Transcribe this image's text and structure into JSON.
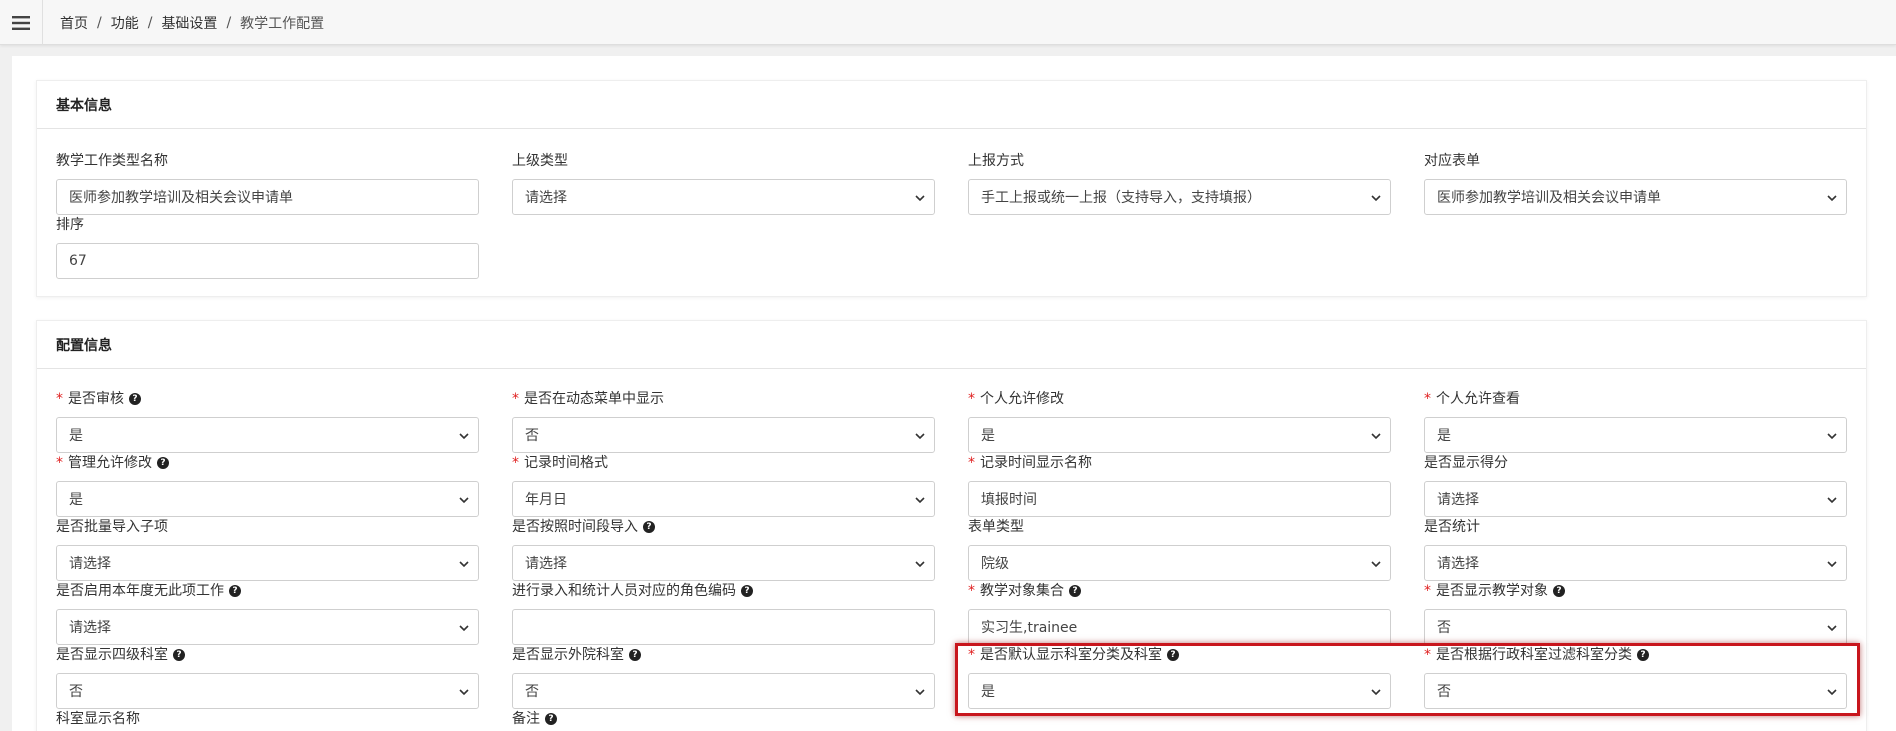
{
  "breadcrumb": {
    "items": [
      "首页",
      "功能",
      "基础设置"
    ],
    "current": "教学工作配置",
    "separator": "/"
  },
  "basic": {
    "title": "基本信息",
    "type_name": {
      "label": "教学工作类型名称",
      "value": "医师参加教学培训及相关会议申请单"
    },
    "parent_type": {
      "label": "上级类型",
      "value": "请选择"
    },
    "report_method": {
      "label": "上报方式",
      "value": "手工上报或统一上报（支持导入，支持填报）"
    },
    "form": {
      "label": "对应表单",
      "value": "医师参加教学培训及相关会议申请单"
    },
    "sort": {
      "label": "排序",
      "value": "67"
    }
  },
  "config": {
    "title": "配置信息",
    "audit": {
      "label": "是否审核",
      "value": "是"
    },
    "dynamic_menu": {
      "label": "是否在动态菜单中显示",
      "value": "否"
    },
    "personal_edit": {
      "label": "个人允许修改",
      "value": "是"
    },
    "personal_view": {
      "label": "个人允许查看",
      "value": "是"
    },
    "admin_edit": {
      "label": "管理允许修改",
      "value": "是"
    },
    "time_format": {
      "label": "记录时间格式",
      "value": "年月日"
    },
    "time_display_name": {
      "label": "记录时间显示名称",
      "value": "填报时间"
    },
    "show_score": {
      "label": "是否显示得分",
      "value": "请选择"
    },
    "batch_import": {
      "label": "是否批量导入子项",
      "value": "请选择"
    },
    "period_import": {
      "label": "是否按照时间段导入",
      "value": "请选择"
    },
    "form_type": {
      "label": "表单类型",
      "value": "院级"
    },
    "statistics": {
      "label": "是否统计",
      "value": "请选择"
    },
    "no_work_year": {
      "label": "是否启用本年度无此项工作",
      "value": "请选择"
    },
    "role_code": {
      "label": "进行录入和统计人员对应的角色编码",
      "value": ""
    },
    "target_set": {
      "label": "教学对象集合",
      "value": "实习生,trainee"
    },
    "show_target": {
      "label": "是否显示教学对象",
      "value": "否"
    },
    "level4_dept": {
      "label": "是否显示四级科室",
      "value": "否"
    },
    "external_dept": {
      "label": "是否显示外院科室",
      "value": "否"
    },
    "default_dept_category": {
      "label": "是否默认显示科室分类及科室",
      "value": "是"
    },
    "filter_by_admin_dept": {
      "label": "是否根据行政科室过滤科室分类",
      "value": "否"
    },
    "dept_display_name": {
      "label": "科室显示名称"
    },
    "remark": {
      "label": "备注"
    }
  }
}
